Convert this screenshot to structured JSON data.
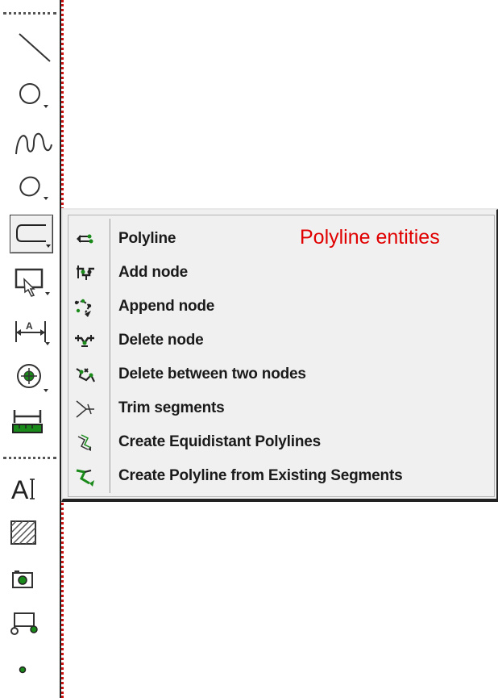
{
  "toolbar": {
    "tools": [
      {
        "icon": "line-icon"
      },
      {
        "icon": "circle-icon"
      },
      {
        "icon": "spline-icon"
      },
      {
        "icon": "ellipse-icon"
      },
      {
        "icon": "polyline-icon",
        "active": true
      },
      {
        "icon": "select-window-icon"
      },
      {
        "icon": "dimension-icon"
      },
      {
        "icon": "snap-target-icon"
      },
      {
        "icon": "measure-ruler-icon"
      },
      {
        "icon": "text-icon"
      },
      {
        "icon": "hatch-icon"
      },
      {
        "icon": "image-insert-icon"
      },
      {
        "icon": "block-icon"
      },
      {
        "icon": "point-icon"
      }
    ]
  },
  "flyout": {
    "items": [
      {
        "label": "Polyline",
        "icon": "polyline-draw-icon"
      },
      {
        "label": "Add node",
        "icon": "add-node-icon"
      },
      {
        "label": "Append node",
        "icon": "append-node-icon"
      },
      {
        "label": "Delete node",
        "icon": "delete-node-icon"
      },
      {
        "label": "Delete between two nodes",
        "icon": "delete-between-nodes-icon"
      },
      {
        "label": "Trim segments",
        "icon": "trim-segments-icon"
      },
      {
        "label": "Create Equidistant Polylines",
        "icon": "equidistant-polylines-icon"
      },
      {
        "label": "Create Polyline from Existing Segments",
        "icon": "polyline-from-segments-icon"
      }
    ]
  },
  "annotation": {
    "text": "Polyline entities",
    "color": "#e00000"
  },
  "colors": {
    "menu_bg": "#f0f0f0",
    "toolbar_edge": "#cc1111",
    "icon_green": "#1a8a1a"
  }
}
